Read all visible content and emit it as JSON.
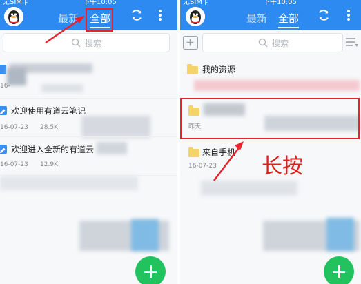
{
  "left": {
    "status": {
      "carrier": "无SIM卡",
      "time": "下午10:05"
    },
    "tabs": {
      "latest": "最新",
      "all": "全部"
    },
    "search": {
      "placeholder": "搜索"
    },
    "notes": [
      {
        "title": "欢迎使用有道云笔记",
        "date": "16-07-23",
        "size": "28.5K"
      },
      {
        "title": "欢迎进入全新的有道云",
        "date": "16-07-23",
        "size": "12.9K"
      }
    ],
    "partial_date": "16-"
  },
  "right": {
    "status": {
      "carrier": "无SIM卡",
      "time": "下午10:05"
    },
    "tabs": {
      "latest": "最新",
      "all": "全部"
    },
    "search": {
      "placeholder": "搜索"
    },
    "folders": [
      {
        "title": "我的资源"
      },
      {
        "title": "",
        "meta": "昨天"
      },
      {
        "title": "来自手机",
        "date": "16-07-23"
      }
    ],
    "annotation": "长按"
  },
  "colors": {
    "header": "#2c8af0",
    "fab": "#22c25f",
    "highlight": "#e8232a",
    "folder": "#f5d36b"
  },
  "icons": [
    "qq-avatar-icon",
    "sync-icon",
    "more-icon",
    "search-icon",
    "add-folder-icon",
    "list-view-icon",
    "note-icon",
    "folder-icon",
    "add-icon",
    "arrow-icon"
  ]
}
